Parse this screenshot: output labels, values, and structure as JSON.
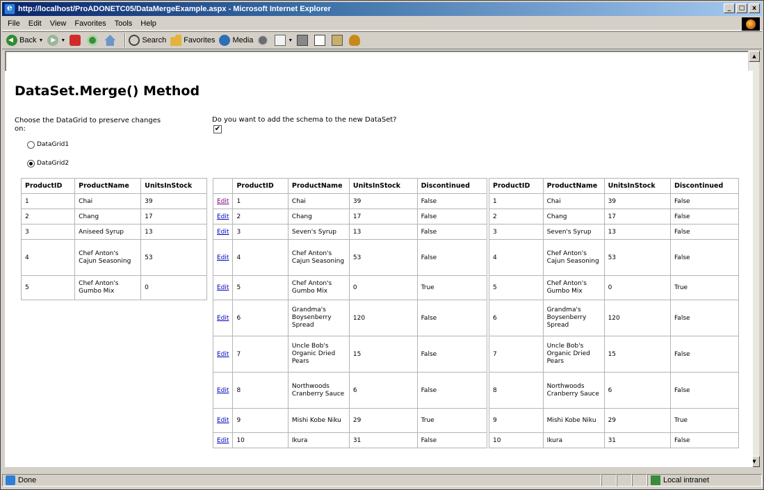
{
  "window": {
    "title": "http://localhost/ProADONETC05/DataMergeExample.aspx - Microsoft Internet Explorer",
    "min": "_",
    "max": "□",
    "close": "x"
  },
  "menu": [
    "File",
    "Edit",
    "View",
    "Favorites",
    "Tools",
    "Help"
  ],
  "toolbar": {
    "back": "Back",
    "search": "Search",
    "favorites": "Favorites",
    "media": "Media"
  },
  "page": {
    "title": "DataSet.Merge() Method",
    "choose_label_line1": "Choose the DataGrid to preserve changes",
    "choose_label_line2": "on:",
    "radio1": "DataGrid1",
    "radio2": "DataGrid2",
    "schema_label": "Do you want to add the schema to the new DataSet?",
    "schema_checked": "✔"
  },
  "grid1": {
    "headers": [
      "ProductID",
      "ProductName",
      "UnitsInStock"
    ],
    "rows": [
      [
        "1",
        "Chai",
        "39"
      ],
      [
        "2",
        "Chang",
        "17"
      ],
      [
        "3",
        "Aniseed Syrup",
        "13"
      ],
      [
        "4",
        "Chef Anton's Cajun Seasoning",
        "53"
      ],
      [
        "5",
        "Chef Anton's Gumbo Mix",
        "0"
      ]
    ]
  },
  "grid2": {
    "edit": "Edit",
    "headers": [
      "",
      "ProductID",
      "ProductName",
      "UnitsInStock",
      "Discontinued"
    ],
    "rows": [
      [
        "1",
        "Chai",
        "39",
        "False"
      ],
      [
        "2",
        "Chang",
        "17",
        "False"
      ],
      [
        "3",
        "Seven's Syrup",
        "13",
        "False"
      ],
      [
        "4",
        "Chef Anton's Cajun Seasoning",
        "53",
        "False"
      ],
      [
        "5",
        "Chef Anton's Gumbo Mix",
        "0",
        "True"
      ],
      [
        "6",
        "Grandma's Boysenberry Spread",
        "120",
        "False"
      ],
      [
        "7",
        "Uncle Bob's Organic Dried Pears",
        "15",
        "False"
      ],
      [
        "8",
        "Northwoods Cranberry Sauce",
        "6",
        "False"
      ],
      [
        "9",
        "Mishi Kobe Niku",
        "29",
        "True"
      ],
      [
        "10",
        "Ikura",
        "31",
        "False"
      ]
    ]
  },
  "grid3": {
    "headers": [
      "ProductID",
      "ProductName",
      "UnitsInStock",
      "Discontinued"
    ],
    "rows": [
      [
        "1",
        "Chai",
        "39",
        "False"
      ],
      [
        "2",
        "Chang",
        "17",
        "False"
      ],
      [
        "3",
        "Seven's Syrup",
        "13",
        "False"
      ],
      [
        "4",
        "Chef Anton's Cajun Seasoning",
        "53",
        "False"
      ],
      [
        "5",
        "Chef Anton's Gumbo Mix",
        "0",
        "True"
      ],
      [
        "6",
        "Grandma's Boysenberry Spread",
        "120",
        "False"
      ],
      [
        "7",
        "Uncle Bob's Organic Dried Pears",
        "15",
        "False"
      ],
      [
        "8",
        "Northwoods Cranberry Sauce",
        "6",
        "False"
      ],
      [
        "9",
        "Mishi Kobe Niku",
        "29",
        "True"
      ],
      [
        "10",
        "Ikura",
        "31",
        "False"
      ]
    ]
  },
  "status": {
    "text": "Done",
    "zone": "Local intranet"
  }
}
